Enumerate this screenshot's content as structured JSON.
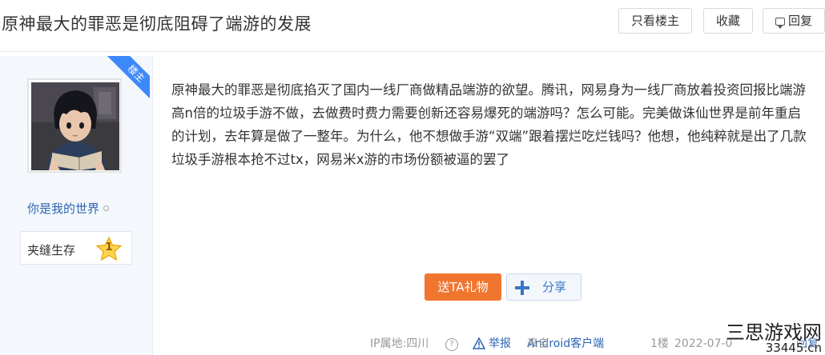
{
  "header": {
    "title": "原神最大的罪恶是彻底阻碍了端游的发展",
    "only_louzhu_label": "只看楼主",
    "collect_label": "收藏",
    "reply_label": "回复"
  },
  "author": {
    "badge": "楼主",
    "name": "你是我的世界",
    "level_name": "夹缝生存",
    "level": "1"
  },
  "post": {
    "content": "原神最大的罪恶是彻底掐灭了国内一线厂商做精品端游的欲望。腾讯，网易身为一线厂商放着投资回报比端游高n倍的垃圾手游不做，去做费时费力需要创新还容易爆死的端游吗？怎么可能。完美做诛仙世界是前年重启的计划，去年算是做了一整年。为什么，他不想做手游“双端”跟着摆烂吃烂钱吗？他想，他纯粹就是出了几款垃圾手游根本抢不过tx，网易米x游的市场份额被逼的罢了"
  },
  "actions": {
    "gift_label": "送TA礼物",
    "share_label": "分享"
  },
  "footer": {
    "ip": "IP属地:四川",
    "help": "?",
    "report": "举报",
    "client_prefix": "来自",
    "client": "Android客户端",
    "floor": "1楼",
    "date": "2022-07-0",
    "reply": "回复"
  },
  "watermark": {
    "main": "三思游戏网",
    "sub": "33445.cn"
  },
  "colors": {
    "accent_blue": "#3e89fa",
    "link_blue": "#2d64b3",
    "gift_orange": "#f0762f",
    "sidebar_bg": "#f4f8fc"
  }
}
